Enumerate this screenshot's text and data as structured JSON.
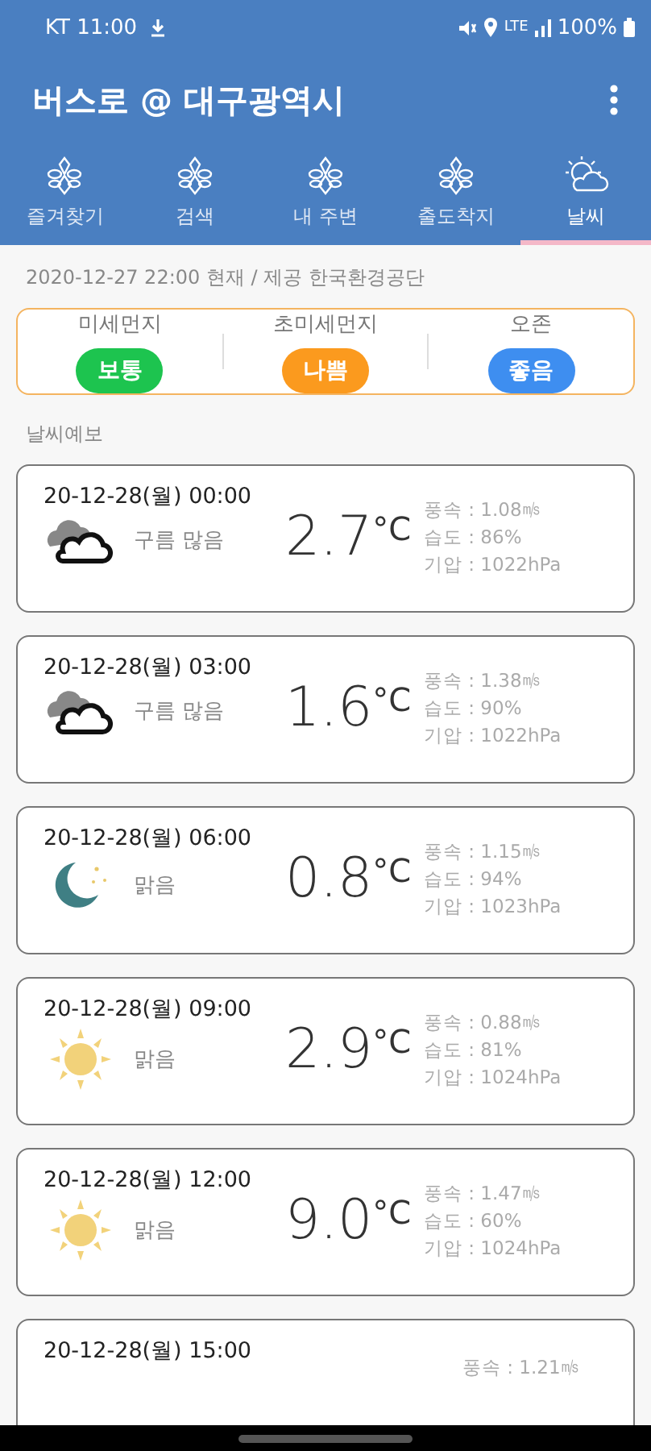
{
  "status_bar": {
    "carrier_time": "KT 11:00",
    "network": "LTE",
    "battery": "100%"
  },
  "app_bar": {
    "title": "버스로 @ 대구광역시"
  },
  "tabs": [
    {
      "label": "즐겨찾기",
      "kind": "flower",
      "selected": false
    },
    {
      "label": "검색",
      "kind": "flower",
      "selected": false
    },
    {
      "label": "내 주변",
      "kind": "flower",
      "selected": false
    },
    {
      "label": "출도착지",
      "kind": "flower",
      "selected": false
    },
    {
      "label": "날씨",
      "kind": "weather",
      "selected": true
    }
  ],
  "air_quality": {
    "source": "2020-12-27 22:00 현재 / 제공 한국환경공단",
    "items": [
      {
        "name": "미세먼지",
        "grade": "보통",
        "color": "#1dc44f"
      },
      {
        "name": "초미세먼지",
        "grade": "나쁨",
        "color": "#fb9a1e"
      },
      {
        "name": "오존",
        "grade": "좋음",
        "color": "#3e8ef0"
      }
    ]
  },
  "forecast_title": "날씨예보",
  "forecasts": [
    {
      "time": "20-12-28(월) 00:00",
      "kind": "cloudy",
      "sky": "구름 많음",
      "temp": "2.7",
      "unit": "°C",
      "wind": "풍속 : 1.08㎧",
      "humidity": "습도 : 86%",
      "pressure": "기압 : 1022hPa"
    },
    {
      "time": "20-12-28(월) 03:00",
      "kind": "cloudy",
      "sky": "구름 많음",
      "temp": "1.6",
      "unit": "°C",
      "wind": "풍속 : 1.38㎧",
      "humidity": "습도 : 90%",
      "pressure": "기압 : 1022hPa"
    },
    {
      "time": "20-12-28(월) 06:00",
      "kind": "moon",
      "sky": "맑음",
      "temp": "0.8",
      "unit": "°C",
      "wind": "풍속 : 1.15㎧",
      "humidity": "습도 : 94%",
      "pressure": "기압 : 1023hPa"
    },
    {
      "time": "20-12-28(월) 09:00",
      "kind": "sun",
      "sky": "맑음",
      "temp": "2.9",
      "unit": "°C",
      "wind": "풍속 : 0.88㎧",
      "humidity": "습도 : 81%",
      "pressure": "기압 : 1024hPa"
    },
    {
      "time": "20-12-28(월) 12:00",
      "kind": "sun",
      "sky": "맑음",
      "temp": "9.0",
      "unit": "°C",
      "wind": "풍속 : 1.47㎧",
      "humidity": "습도 : 60%",
      "pressure": "기압 : 1024hPa"
    },
    {
      "time": "20-12-28(월) 15:00",
      "wind": "풍속 : 1.21㎧"
    }
  ]
}
